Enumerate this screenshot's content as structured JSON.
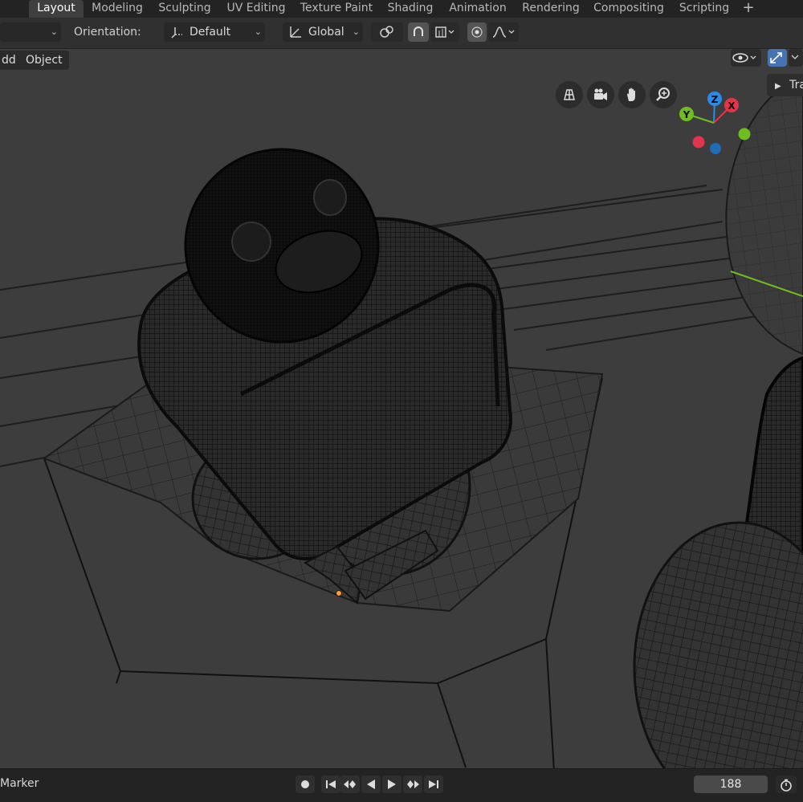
{
  "workspace_tabs": [
    {
      "label": "Layout",
      "active": true
    },
    {
      "label": "Modeling"
    },
    {
      "label": "Sculpting"
    },
    {
      "label": "UV Editing"
    },
    {
      "label": "Texture Paint"
    },
    {
      "label": "Shading"
    },
    {
      "label": "Animation"
    },
    {
      "label": "Rendering"
    },
    {
      "label": "Compositing"
    },
    {
      "label": "Scripting"
    }
  ],
  "header": {
    "orientation_label": "Orientation:",
    "orientation_value": "Default",
    "transform_space": "Global"
  },
  "viewport_menu": {
    "add": "dd",
    "object": "Object"
  },
  "side_panel_tab": "Tra",
  "gizmo": {
    "x": "X",
    "y": "Y",
    "z": "Z"
  },
  "timeline": {
    "marker_label": "Marker",
    "current_frame": "188"
  },
  "colors": {
    "axis_x": "#e2344a",
    "axis_y": "#6ebe20",
    "axis_z": "#2b8ce8",
    "active_tab": "#3f3f3f",
    "viewport_bg": "#3d3d3d",
    "accent_blue": "#4772b3"
  }
}
